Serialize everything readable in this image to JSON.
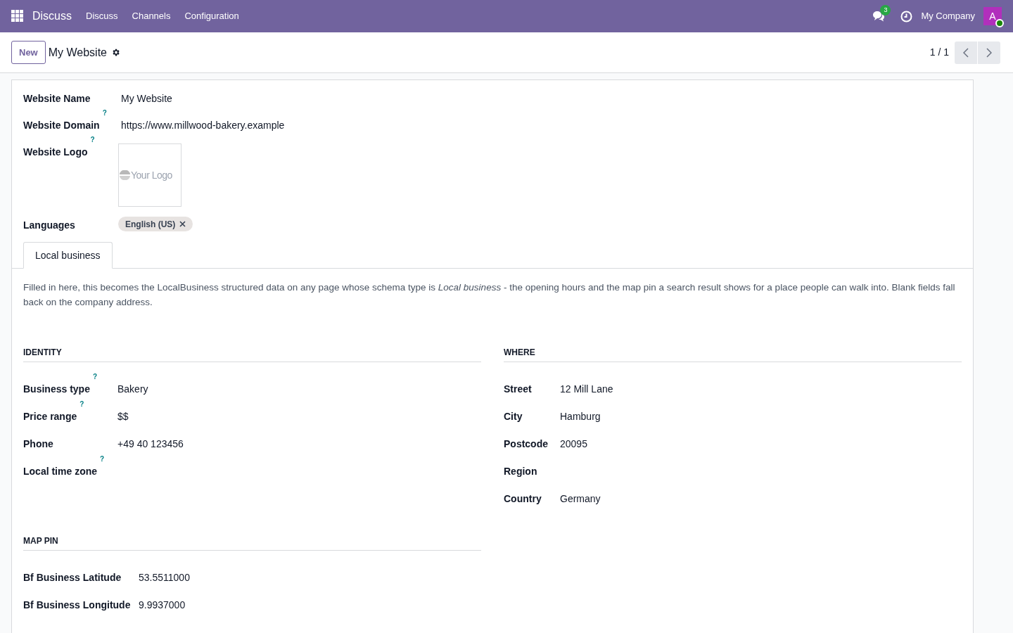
{
  "navbar": {
    "app_name": "Discuss",
    "menu": [
      "Discuss",
      "Channels",
      "Configuration"
    ],
    "messages_count": "3",
    "company": "My Company",
    "avatar_letter": "A",
    "avatar_online": true
  },
  "control_panel": {
    "new_button": "New",
    "breadcrumb": "My Website",
    "pager": "1 / 1"
  },
  "form": {
    "fields": [
      {
        "label": "Website Name",
        "kind": "text",
        "value": "My Website"
      },
      {
        "label": "Website Domain",
        "help": "?",
        "kind": "text",
        "value": "https://www.millwood-bakery.example"
      },
      {
        "label": "Website Logo",
        "help": "?",
        "kind": "image",
        "value": "Your Logo"
      },
      {
        "label": "Languages",
        "kind": "tags",
        "tags": [
          "English (US)"
        ]
      }
    ],
    "tabs": [
      {
        "label": "Local business",
        "selected": true
      }
    ],
    "description": "Filled in here, this becomes the LocalBusiness structured data on any page whose schema type is *Local business* - the opening hours and the map pin a search result shows for a place people can walk into. Blank fields fall back on the company address.",
    "groups": [
      {
        "title": "IDENTITY",
        "fields": [
          {
            "label": "Business type",
            "help": "?",
            "value": "Bakery"
          },
          {
            "label": "Price range",
            "help": "?",
            "value": "$$"
          },
          {
            "label": "Phone",
            "value": "+49 40 123456"
          },
          {
            "label": "Local time zone",
            "help": "?"
          }
        ]
      },
      {
        "title": "WHERE",
        "fields": [
          {
            "label": "Street",
            "value": "12 Mill Lane"
          },
          {
            "label": "City",
            "value": "Hamburg"
          },
          {
            "label": "Postcode",
            "value": "20095"
          },
          {
            "label": "Region"
          },
          {
            "label": "Country",
            "value": "Germany"
          }
        ]
      },
      {
        "title": "MAP PIN",
        "fields": [
          {
            "label": "Bf Business Latitude",
            "value": "53.5511000"
          },
          {
            "label": "Bf Business Longitude",
            "value": "9.9937000"
          }
        ]
      }
    ]
  }
}
